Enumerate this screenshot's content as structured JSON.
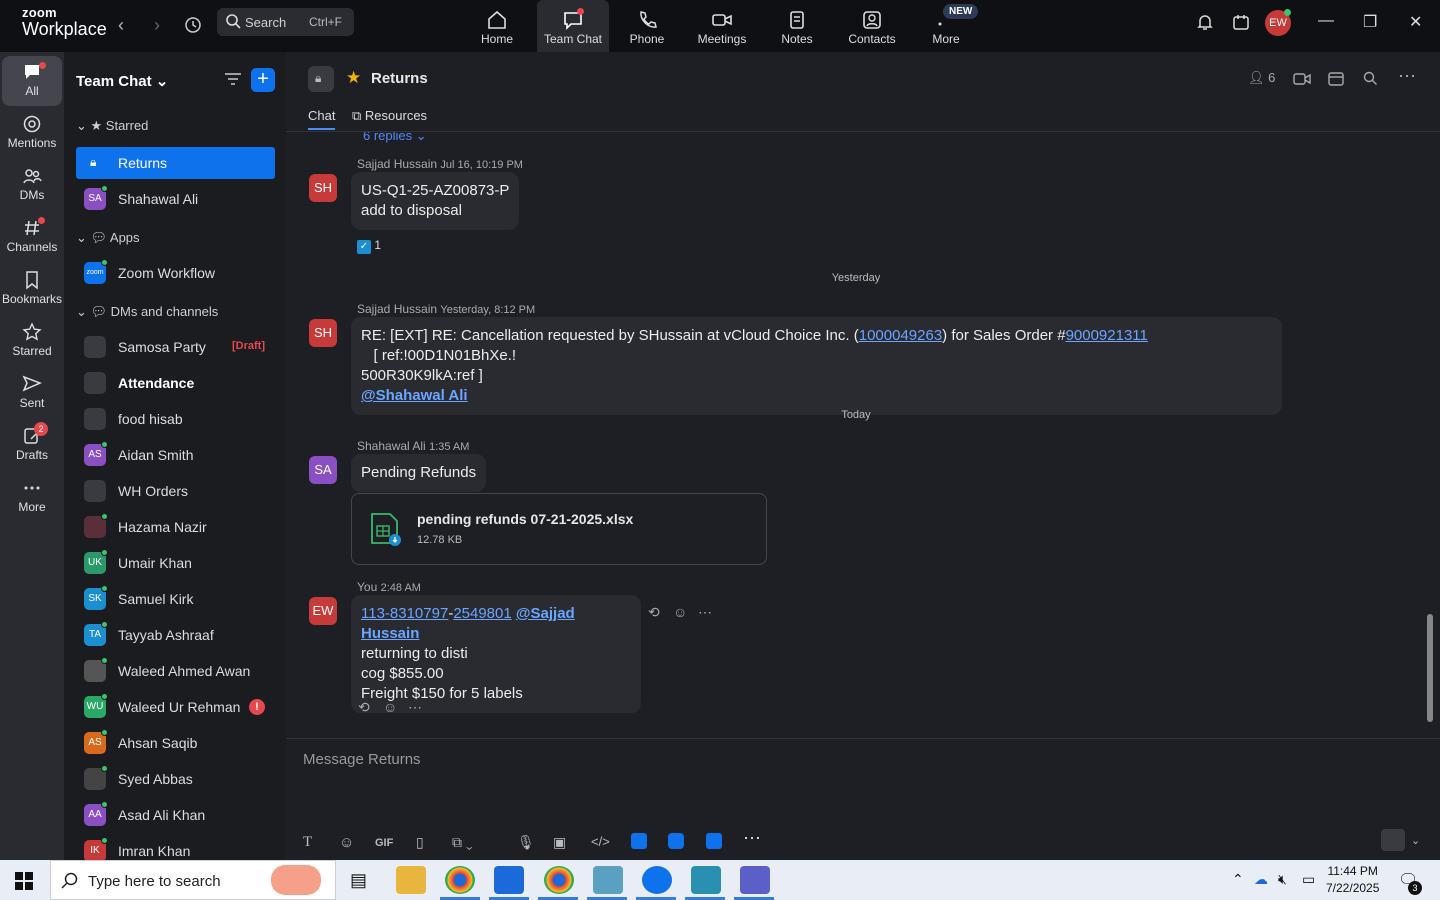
{
  "app": {
    "logo_small": "zoom",
    "logo_big": "Workplace"
  },
  "topbar": {
    "search_label": "Search",
    "search_shortcut": "Ctrl+F",
    "tabs": [
      {
        "label": "Home",
        "icon": "home-icon"
      },
      {
        "label": "Team Chat",
        "icon": "chat-icon"
      },
      {
        "label": "Phone",
        "icon": "phone-icon"
      },
      {
        "label": "Meetings",
        "icon": "camera-icon"
      },
      {
        "label": "Notes",
        "icon": "notes-icon"
      },
      {
        "label": "Contacts",
        "icon": "contacts-icon"
      },
      {
        "label": "More",
        "icon": "more-icon"
      }
    ],
    "new_badge": "NEW",
    "avatar": "EW"
  },
  "rail": {
    "items": [
      {
        "label": "All"
      },
      {
        "label": "Mentions"
      },
      {
        "label": "DMs"
      },
      {
        "label": "Channels"
      },
      {
        "label": "Bookmarks"
      },
      {
        "label": "Starred"
      },
      {
        "label": "Sent"
      },
      {
        "label": "Drafts",
        "count": "2"
      },
      {
        "label": "More"
      }
    ]
  },
  "sidebar": {
    "title": "Team Chat",
    "sections": {
      "starred": "Starred",
      "apps": "Apps",
      "dms": "DMs and channels"
    },
    "starred": [
      {
        "name": "Returns",
        "initials": ""
      },
      {
        "name": "Shahawal Ali",
        "initials": "SA"
      }
    ],
    "apps": [
      {
        "name": "Zoom Workflow",
        "initials": "zoom"
      }
    ],
    "dms": [
      {
        "name": "Samosa Party",
        "initials": "",
        "draft": "[Draft]"
      },
      {
        "name": "Attendance",
        "initials": ""
      },
      {
        "name": "food hisab",
        "initials": ""
      },
      {
        "name": "Aidan Smith",
        "initials": "AS"
      },
      {
        "name": "WH Orders",
        "initials": ""
      },
      {
        "name": "Hazama Nazir",
        "initials": ""
      },
      {
        "name": "Umair Khan",
        "initials": "UK"
      },
      {
        "name": "Samuel Kirk",
        "initials": "SK"
      },
      {
        "name": "Tayyab Ashraaf",
        "initials": "TA"
      },
      {
        "name": "Waleed Ahmed Awan",
        "initials": ""
      },
      {
        "name": "Waleed Ur Rehman",
        "initials": "WU",
        "alert": "!"
      },
      {
        "name": "Ahsan Saqib",
        "initials": "AS"
      },
      {
        "name": "Syed Abbas",
        "initials": ""
      },
      {
        "name": "Asad Ali Khan",
        "initials": "AA"
      },
      {
        "name": "Imran Khan",
        "initials": "IK"
      }
    ]
  },
  "channel": {
    "title": "Returns",
    "tabs": {
      "chat": "Chat",
      "resources": "Resources"
    },
    "member_count": "6",
    "replies": "6 replies"
  },
  "messages": {
    "m1": {
      "sender": "Sajjad Hussain",
      "time": "Jul 16, 10:19 PM",
      "initials": "SH",
      "lines": [
        "US-Q1-25-AZ00873-P",
        "add to disposal"
      ],
      "reaction": "1"
    },
    "sep1": "Yesterday",
    "m2": {
      "sender": "Sajjad Hussain",
      "time": "Yesterday, 8:12 PM",
      "initials": "SH",
      "pre": "RE: [EXT] RE: Cancellation requested by SHussain at vCloud Choice Inc. (",
      "link1": "1000049263",
      "mid": ") for Sales Order #",
      "link2": "9000921311",
      "post": "   [ ref:!00D1N01BhXe.!",
      "line2": "500R30K9lkA:ref ]",
      "mention": "@Shahawal Ali"
    },
    "sep2": "Today",
    "m3": {
      "sender": "Shahawal Ali",
      "time": "1:35 AM",
      "initials": "SA",
      "text": "Pending Refunds",
      "file_name": "pending refunds 07-21-2025.xlsx",
      "file_size": "12.78 KB"
    },
    "m4": {
      "sender": "You",
      "time": "2:48 AM",
      "initials": "EW",
      "link1": "113-8310797",
      "dash": "-",
      "link2": "2549801",
      "mention": "@Sajjad Hussain",
      "lines": [
        "returning to disti",
        "cog $855.00",
        "Freight $150 for 5 labels"
      ]
    }
  },
  "composer": {
    "placeholder": "Message Returns",
    "gif": "GIF"
  },
  "taskbar": {
    "search": "Type here to search",
    "time": "11:44 PM",
    "date": "7/22/2025",
    "notif_count": "3"
  }
}
